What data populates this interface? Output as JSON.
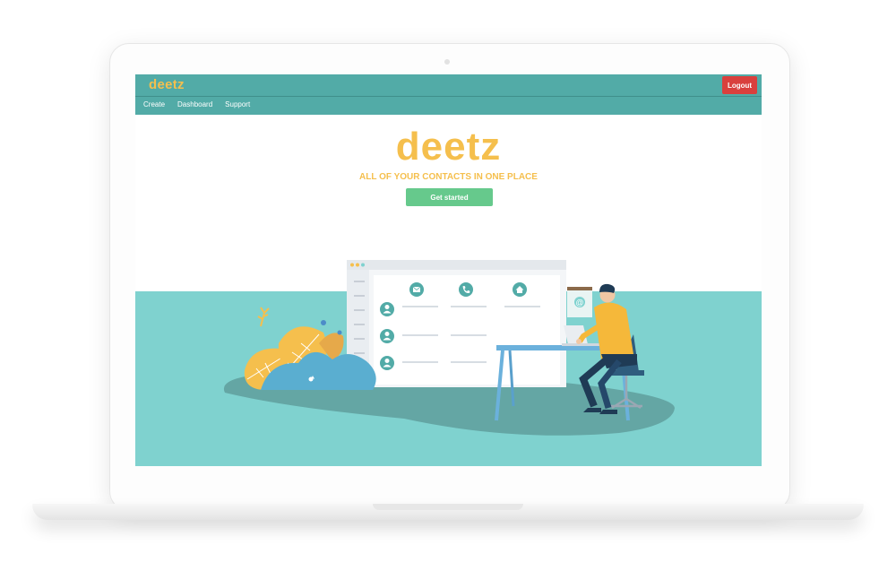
{
  "navbar": {
    "brand": "deetz",
    "logout_label": "Logout",
    "links": [
      "Create",
      "Dashboard",
      "Support"
    ]
  },
  "hero": {
    "logo": "deetz",
    "tagline": "ALL OF YOUR CONTACTS IN ONE PLACE",
    "cta_label": "Get started"
  },
  "illustration": {
    "icons": [
      "mail-icon",
      "phone-icon",
      "home-icon",
      "user-avatar-icon",
      "at-sign-icon",
      "laptop-icon"
    ]
  },
  "colors": {
    "navbar": "#52aba7",
    "brand": "#f5bf4d",
    "logout": "#d9403d",
    "cta": "#66c98c",
    "teal_band": "#7fd2cf"
  }
}
